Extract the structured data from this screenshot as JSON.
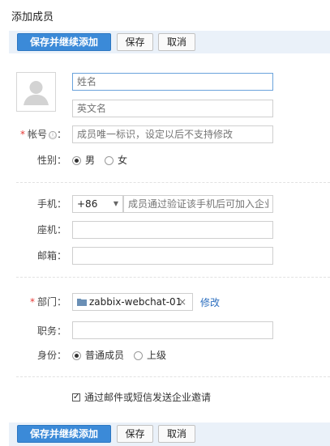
{
  "page": {
    "title": "添加成员"
  },
  "toolbar": {
    "save_continue_label": "保存并继续添加",
    "save_label": "保存",
    "cancel_label": "取消"
  },
  "form": {
    "name": {
      "placeholder": "姓名"
    },
    "english_name": {
      "placeholder": "英文名"
    },
    "account": {
      "label": "帐号",
      "info_icon": "ⓘ",
      "placeholder": "成员唯一标识，设定以后不支持修改"
    },
    "gender": {
      "label": "性别：",
      "options": [
        "男",
        "女"
      ],
      "selected": "男"
    },
    "mobile": {
      "label": "手机：",
      "country_code": "+86",
      "placeholder": "成员通过验证该手机后可加入企业"
    },
    "landline": {
      "label": "座机："
    },
    "email": {
      "label": "邮箱："
    },
    "department": {
      "label": "部门：",
      "value": "zabbix-webchat-01",
      "remove_symbol": "×",
      "edit_label": "修改"
    },
    "position": {
      "label": "职务："
    },
    "identity": {
      "label": "身份：",
      "options": [
        "普通成员",
        "上级"
      ],
      "selected": "普通成员"
    },
    "invite": {
      "label": "通过邮件或短信发送企业邀请",
      "checked": true
    }
  },
  "colors": {
    "primary": "#3b8ad8",
    "toolbar_bg": "#eaf1f9",
    "required": "#e53935",
    "link": "#2d6fbf"
  },
  "icons": {
    "avatar": "avatar-placeholder-icon",
    "folder": "folder-icon"
  }
}
